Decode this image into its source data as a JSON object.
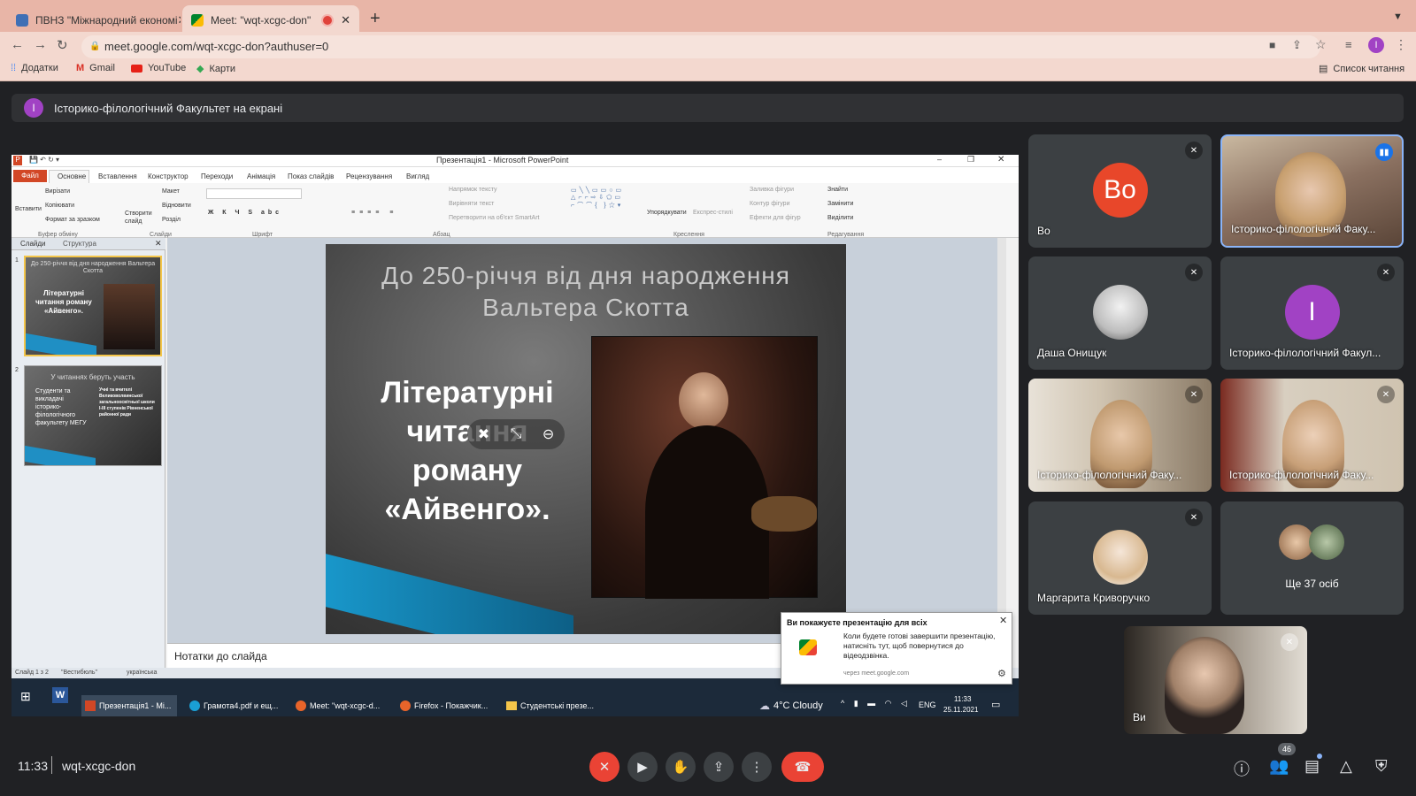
{
  "browser": {
    "tabs": [
      {
        "label": "ПВНЗ \"Міжнародний економі",
        "active": false
      },
      {
        "label": "Meet: \"wqt-xcgc-don\"",
        "active": true
      }
    ],
    "new_tab": "+",
    "url": "meet.google.com/wqt-xcgc-don?authuser=0",
    "bookmarks": [
      "Додатки",
      "Gmail",
      "YouTube",
      "Карти"
    ],
    "reading_list": "Список читання",
    "profile_initial": "I"
  },
  "meet": {
    "banner_initial": "I",
    "banner_text": "Історико-філологічний Факультет на екрані",
    "participants": [
      {
        "name": "Во",
        "initial": "Во",
        "color": "#e8472a"
      },
      {
        "name": "Історико-філологічний Факу..."
      },
      {
        "name": "Даша Онищук"
      },
      {
        "name": "Історико-філологічний Факул...",
        "initial": "I",
        "color": "#a142c4"
      },
      {
        "name": "Історико-філологічний Факу..."
      },
      {
        "name": "Історико-філологічний Факу..."
      },
      {
        "name": "Маргарита Криворучко"
      },
      {
        "name": "Ще 37 осіб"
      }
    ],
    "self_name": "Ви",
    "time": "11:33",
    "meeting_code": "wqt-xcgc-don",
    "people_count": "46"
  },
  "ppt": {
    "title": "Презентація1 - Microsoft PowerPoint",
    "file_tab": "Файл",
    "tabs": [
      "Основне",
      "Вставлення",
      "Конструктор",
      "Переходи",
      "Анімація",
      "Показ слайдів",
      "Рецензування",
      "Вигляд"
    ],
    "groups": [
      "Буфер обміну",
      "Слайди",
      "Шрифт",
      "Абзац",
      "Креслення",
      "Редагування"
    ],
    "ribbon_items": {
      "paste": "Вставити",
      "cut": "Вирізати",
      "copy": "Копіювати",
      "format_painter": "Формат за зразком",
      "new_slide": "Створити слайд",
      "layout": "Макет",
      "reset": "Відновити",
      "section": "Розділ",
      "text_direction": "Напрямок тексту",
      "align_text": "Вирівняти текст",
      "smartart": "Перетворити на об'єкт SmartArt",
      "arrange": "Упорядкувати",
      "quick_styles": "Експрес-стилі",
      "shape_fill": "Заливка фігури",
      "shape_outline": "Контур фігури",
      "shape_effects": "Ефекти для фігур",
      "find": "Знайти",
      "replace": "Замінити",
      "select": "Виділити"
    },
    "pane_tabs": [
      "Слайди",
      "Структура"
    ],
    "thumbs": [
      {
        "num": "1",
        "title": "До 250-річчя від дня народження Вальтера Скотта",
        "body": "Літературні читання роману «Айвенго»."
      },
      {
        "num": "2",
        "title": "У читаннях беруть участь",
        "bullets": "Студенти та викладачі історико-філологічного факультету МЕГУ",
        "right": "Учні та вчителі Великоволвинської загальноосвітньої школи І-ІІІ ступенів Рівненської районної ради"
      }
    ],
    "slide_title": "До 250-річчя від дня народження Вальтера Скотта",
    "slide_body": "Літературні читання роману «Айвенго».",
    "notes": "Нотатки до слайда",
    "status_slide": "Слайд 1 з 2",
    "status_theme": "\"Вестибюль\"",
    "status_lang": "українська"
  },
  "notification": {
    "title": "Ви покажуєте презентацію для всіх",
    "body": "Коли будете готові завершити презентацію, натисніть тут, щоб повернутися до відеодзвінка.",
    "source": "через meet.google.com"
  },
  "taskbar": {
    "items": [
      "Презентація1 - Mi...",
      "Грамота4.pdf и ещ...",
      "Meet: \"wqt-xcgc-d...",
      "Firefox - Покажчик...",
      "Студентські презе..."
    ],
    "weather": "4°C  Cloudy",
    "lang": "ENG",
    "time": "11:33",
    "date": "25.11.2021"
  }
}
